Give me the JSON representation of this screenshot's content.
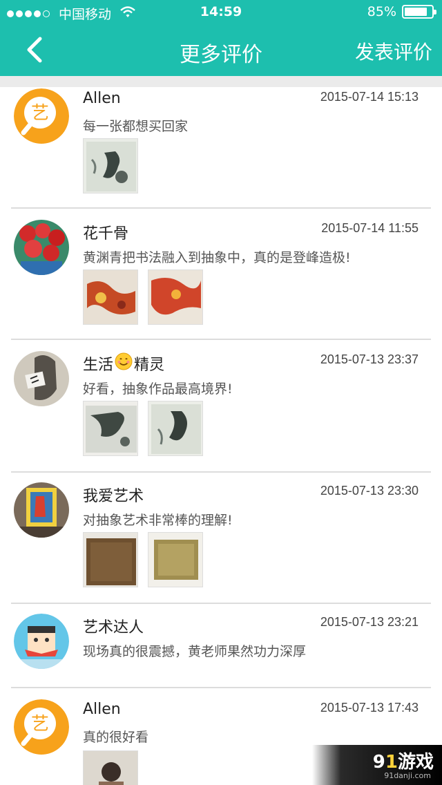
{
  "status_bar": {
    "carrier": "中国移动",
    "time": "14:59",
    "battery": "85%",
    "battery_level": 0.85
  },
  "nav": {
    "title": "更多评价",
    "post_label": "发表评价",
    "back_icon": "chevron-left-icon"
  },
  "colors": {
    "header": "#1dbfae",
    "divider": "#dcdcdc",
    "background": "#ffffff"
  },
  "reviews": [
    {
      "name": "Allen",
      "time": "2015-07-14 15:13",
      "comment": "每一张都想买回家",
      "avatar": "art-logo-avatar",
      "thumbs": [
        "abstract-painting-thumb"
      ]
    },
    {
      "name": "花千骨",
      "time": "2015-07-14 11:55",
      "comment": "黄渊青把书法融入到抽象中，真的是登峰造极!",
      "avatar": "red-flowers-avatar",
      "thumbs": [
        "red-abstract-thumb",
        "red-abstract-thumb"
      ]
    },
    {
      "name_prefix": "生活",
      "name_suffix": "精灵",
      "time": "2015-07-13 23:37",
      "comment": "好看，抽象作品最高境界!",
      "avatar": "cat-photo-avatar",
      "emoji": "smile-emoji",
      "thumbs": [
        "abstract-painting-thumb",
        "abstract-painting-thumb"
      ]
    },
    {
      "name": "我爱艺术",
      "time": "2015-07-13 23:30",
      "comment": "对抽象艺术非常棒的理解!",
      "avatar": "gallery-photo-avatar",
      "thumbs": [
        "brown-painting-thumb",
        "gold-painting-thumb"
      ]
    },
    {
      "name": "艺术达人",
      "time": "2015-07-13 23:21",
      "comment": "现场真的很震撼，黄老师果然功力深厚",
      "avatar": "cartoon-avatar",
      "thumbs": []
    },
    {
      "name": "Allen",
      "time": "2015-07-13 17:43",
      "comment": "真的很好看",
      "avatar": "art-logo-avatar",
      "thumbs": [
        "person-photo-thumb"
      ]
    }
  ],
  "watermark": {
    "brand_num": "9",
    "brand_text": "游戏",
    "site": "91danji.com"
  }
}
